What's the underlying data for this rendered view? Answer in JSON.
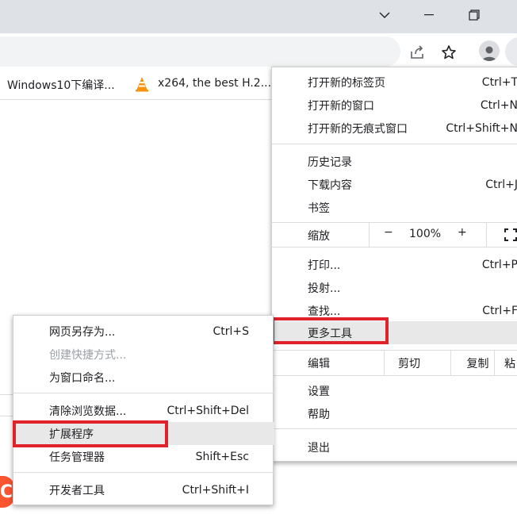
{
  "titlebar": {
    "minimize_icon": "minimize-icon",
    "restore_icon": "restore-icon",
    "chevron_icon": "chevron-down-icon"
  },
  "toolbar": {
    "share_icon": "share-icon",
    "star_icon": "star-icon",
    "profile_icon": "profile-icon"
  },
  "bookmarks": [
    {
      "label": "Windows10下编译..."
    },
    {
      "label": "x264, the best H.2...",
      "icon": "vlc-cone-icon"
    }
  ],
  "menu": {
    "new_tab": {
      "label": "打开新的标签页",
      "shortcut": "Ctrl+T"
    },
    "new_window": {
      "label": "打开新的窗口",
      "shortcut": "Ctrl+N"
    },
    "new_incognito": {
      "label": "打开新的无痕式窗口",
      "shortcut": "Ctrl+Shift+N"
    },
    "history": {
      "label": "历史记录"
    },
    "downloads": {
      "label": "下载内容",
      "shortcut": "Ctrl+J"
    },
    "bookmarks": {
      "label": "书签"
    },
    "zoom": {
      "label": "缩放",
      "minus": "−",
      "value": "100%",
      "plus": "+"
    },
    "print": {
      "label": "打印...",
      "shortcut": "Ctrl+P"
    },
    "cast": {
      "label": "投射..."
    },
    "find": {
      "label": "查找...",
      "shortcut": "Ctrl+F"
    },
    "more_tools": {
      "label": "更多工具"
    },
    "edit": {
      "label": "编辑",
      "cut": "剪切",
      "copy": "复制",
      "paste": "粘"
    },
    "settings": {
      "label": "设置"
    },
    "help": {
      "label": "帮助"
    },
    "exit": {
      "label": "退出"
    }
  },
  "submenu": {
    "save_page": {
      "label": "网页另存为...",
      "shortcut": "Ctrl+S"
    },
    "create_shortcut": {
      "label": "创建快捷方式..."
    },
    "name_window": {
      "label": "为窗口命名..."
    },
    "clear_data": {
      "label": "清除浏览数据...",
      "shortcut": "Ctrl+Shift+Del"
    },
    "extensions": {
      "label": "扩展程序"
    },
    "task_manager": {
      "label": "任务管理器",
      "shortcut": "Shift+Esc"
    },
    "dev_tools": {
      "label": "开发者工具",
      "shortcut": "Ctrl+Shift+I"
    }
  },
  "colors": {
    "highlight_box": "#e0222b",
    "hover_bg": "#e8e8e8",
    "logo_orange": "#fc5531"
  },
  "page": {
    "logo_letter": "C"
  }
}
